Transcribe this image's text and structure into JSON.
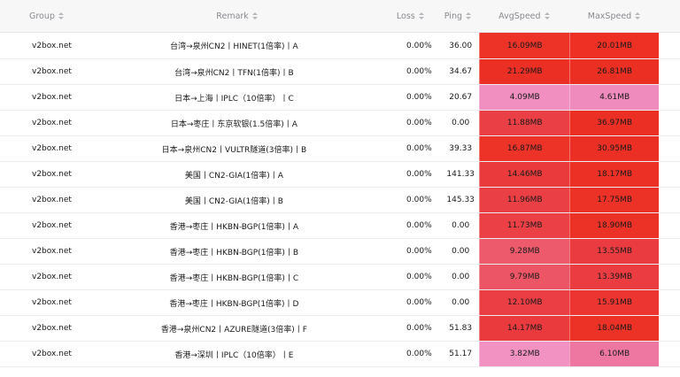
{
  "table": {
    "columns": [
      {
        "key": "group",
        "label": "Group"
      },
      {
        "key": "remark",
        "label": "Remark"
      },
      {
        "key": "loss",
        "label": "Loss"
      },
      {
        "key": "ping",
        "label": "Ping"
      },
      {
        "key": "avg",
        "label": "AvgSpeed"
      },
      {
        "key": "max",
        "label": "MaxSpeed"
      }
    ],
    "rows": [
      {
        "group": "v2box.net",
        "remark": "台湾→泉州CN2丨HINET(1倍率)丨A",
        "loss": "0.00%",
        "ping": "36.00",
        "avg": "16.09MB",
        "max": "20.01MB",
        "avg_color": "#ed3328",
        "max_color": "#ed2f24"
      },
      {
        "group": "v2box.net",
        "remark": "台湾→泉州CN2丨TFN(1倍率)丨B",
        "loss": "0.00%",
        "ping": "34.67",
        "avg": "21.29MB",
        "max": "26.81MB",
        "avg_color": "#ec2f24",
        "max_color": "#ec2f23"
      },
      {
        "group": "v2box.net",
        "remark": "日本→上海丨IPLC（10倍率）丨C",
        "loss": "0.00%",
        "ping": "20.67",
        "avg": "4.09MB",
        "max": "4.61MB",
        "avg_color": "#f08fc0",
        "max_color": "#f08bbd"
      },
      {
        "group": "v2box.net",
        "remark": "日本→枣庄丨东京软银(1.5倍率)丨A",
        "loss": "0.00%",
        "ping": "0.00",
        "avg": "11.88MB",
        "max": "36.97MB",
        "avg_color": "#ea3f45",
        "max_color": "#ec2f24"
      },
      {
        "group": "v2box.net",
        "remark": "日本→泉州CN2丨VULTR隧道(3倍率)丨B",
        "loss": "0.00%",
        "ping": "39.33",
        "avg": "16.87MB",
        "max": "30.95MB",
        "avg_color": "#ed3328",
        "max_color": "#ec2f24"
      },
      {
        "group": "v2box.net",
        "remark": "美国丨CN2-GIA(1倍率)丨A",
        "loss": "0.00%",
        "ping": "141.33",
        "avg": "14.46MB",
        "max": "18.17MB",
        "avg_color": "#ea3a3c",
        "max_color": "#ec3025"
      },
      {
        "group": "v2box.net",
        "remark": "美国丨CN2-GIA(1倍率)丨B",
        "loss": "0.00%",
        "ping": "145.33",
        "avg": "11.96MB",
        "max": "17.75MB",
        "avg_color": "#ea3f45",
        "max_color": "#ec3126"
      },
      {
        "group": "v2box.net",
        "remark": "香港→枣庄丨HKBN-BGP(1倍率)丨A",
        "loss": "0.00%",
        "ping": "0.00",
        "avg": "11.73MB",
        "max": "18.90MB",
        "avg_color": "#ea4046",
        "max_color": "#ec3126"
      },
      {
        "group": "v2box.net",
        "remark": "香港→枣庄丨HKBN-BGP(1倍率)丨B",
        "loss": "0.00%",
        "ping": "0.00",
        "avg": "9.28MB",
        "max": "13.55MB",
        "avg_color": "#ec5a6b",
        "max_color": "#ea3c40"
      },
      {
        "group": "v2box.net",
        "remark": "香港→枣庄丨HKBN-BGP(1倍率)丨C",
        "loss": "0.00%",
        "ping": "0.00",
        "avg": "9.79MB",
        "max": "13.39MB",
        "avg_color": "#ec5565",
        "max_color": "#ea3c41"
      },
      {
        "group": "v2box.net",
        "remark": "香港→枣庄丨HKBN-BGP(1倍率)丨D",
        "loss": "0.00%",
        "ping": "0.00",
        "avg": "12.10MB",
        "max": "15.91MB",
        "avg_color": "#ea3e44",
        "max_color": "#ec3430"
      },
      {
        "group": "v2box.net",
        "remark": "香港→泉州CN2丨AZURE隧道(3倍率)丨F",
        "loss": "0.00%",
        "ping": "51.83",
        "avg": "14.17MB",
        "max": "18.04MB",
        "avg_color": "#ea3a3d",
        "max_color": "#ec3126"
      },
      {
        "group": "v2box.net",
        "remark": "香港→深圳丨IPLC（10倍率）丨E",
        "loss": "0.00%",
        "ping": "51.17",
        "avg": "3.82MB",
        "max": "6.10MB",
        "avg_color": "#f192c3",
        "max_color": "#ee77a2"
      }
    ]
  }
}
